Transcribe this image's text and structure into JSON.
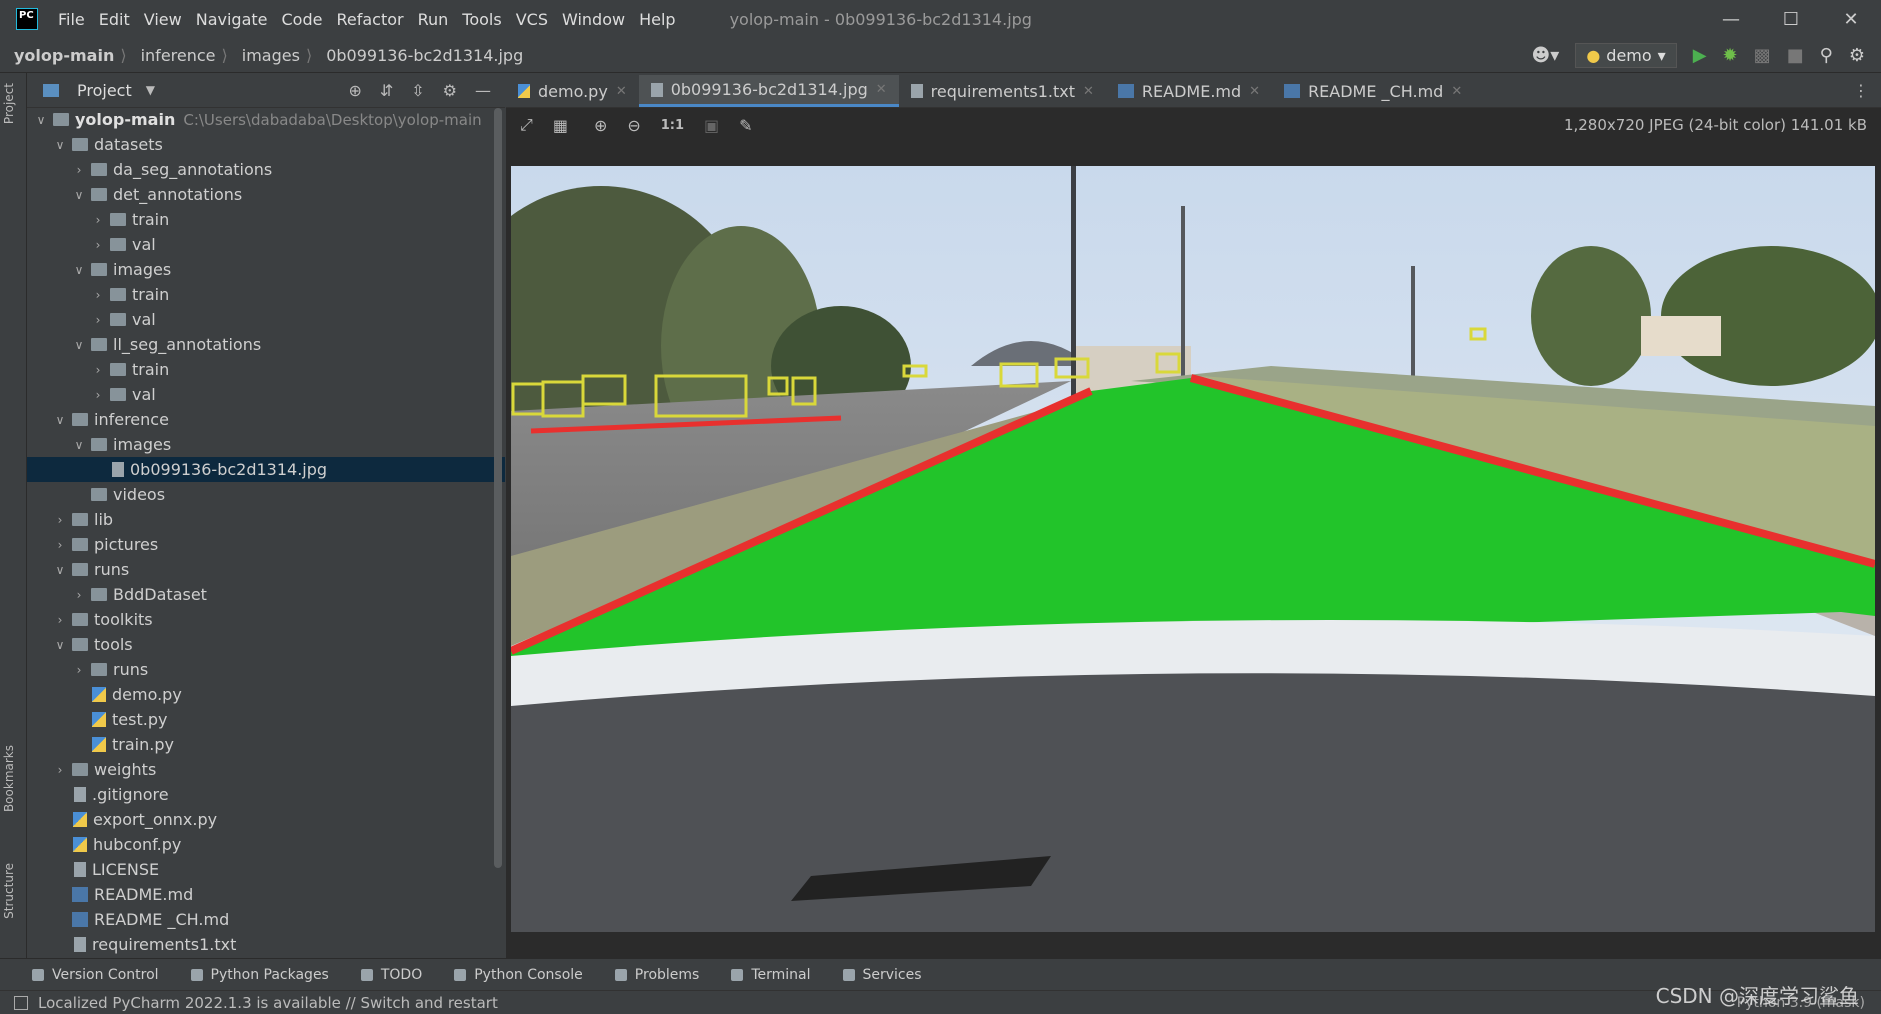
{
  "window": {
    "menu": [
      "File",
      "Edit",
      "View",
      "Navigate",
      "Code",
      "Refactor",
      "Run",
      "Tools",
      "VCS",
      "Window",
      "Help"
    ],
    "title": "yolop-main - 0b099136-bc2d1314.jpg"
  },
  "navbar": {
    "crumbs": [
      "yolop-main",
      "inference",
      "images",
      "0b099136-bc2d1314.jpg"
    ],
    "run_config": "demo"
  },
  "left_stripe": {
    "project": "Project",
    "bookmarks": "Bookmarks",
    "structure": "Structure"
  },
  "project": {
    "title": "Project",
    "root_path": "C:\\Users\\dabadaba\\Desktop\\yolop-main",
    "tree": [
      {
        "label": "yolop-main",
        "level": 0,
        "kind": "folder",
        "expanded": true,
        "bold": true
      },
      {
        "label": "datasets",
        "level": 1,
        "kind": "folder",
        "expanded": true
      },
      {
        "label": "da_seg_annotations",
        "level": 2,
        "kind": "folder",
        "expanded": false
      },
      {
        "label": "det_annotations",
        "level": 2,
        "kind": "folder",
        "expanded": true
      },
      {
        "label": "train",
        "level": 3,
        "kind": "folder",
        "expanded": false
      },
      {
        "label": "val",
        "level": 3,
        "kind": "folder",
        "expanded": false
      },
      {
        "label": "images",
        "level": 2,
        "kind": "folder",
        "expanded": true
      },
      {
        "label": "train",
        "level": 3,
        "kind": "folder",
        "expanded": false
      },
      {
        "label": "val",
        "level": 3,
        "kind": "folder",
        "expanded": false
      },
      {
        "label": "ll_seg_annotations",
        "level": 2,
        "kind": "folder",
        "expanded": true
      },
      {
        "label": "train",
        "level": 3,
        "kind": "folder",
        "expanded": false
      },
      {
        "label": "val",
        "level": 3,
        "kind": "folder",
        "expanded": false
      },
      {
        "label": "inference",
        "level": 1,
        "kind": "folder",
        "expanded": true
      },
      {
        "label": "images",
        "level": 2,
        "kind": "folder",
        "expanded": true
      },
      {
        "label": "0b099136-bc2d1314.jpg",
        "level": 3,
        "kind": "file",
        "selected": true
      },
      {
        "label": "videos",
        "level": 2,
        "kind": "folder",
        "leaf": true
      },
      {
        "label": "lib",
        "level": 1,
        "kind": "folder",
        "expanded": false
      },
      {
        "label": "pictures",
        "level": 1,
        "kind": "folder",
        "expanded": false
      },
      {
        "label": "runs",
        "level": 1,
        "kind": "folder",
        "expanded": true
      },
      {
        "label": "BddDataset",
        "level": 2,
        "kind": "folder",
        "expanded": false
      },
      {
        "label": "toolkits",
        "level": 1,
        "kind": "folder",
        "expanded": false
      },
      {
        "label": "tools",
        "level": 1,
        "kind": "folder",
        "expanded": true
      },
      {
        "label": "runs",
        "level": 2,
        "kind": "folder",
        "expanded": false
      },
      {
        "label": "demo.py",
        "level": 2,
        "kind": "py"
      },
      {
        "label": "test.py",
        "level": 2,
        "kind": "py"
      },
      {
        "label": "train.py",
        "level": 2,
        "kind": "py"
      },
      {
        "label": "weights",
        "level": 1,
        "kind": "folder",
        "expanded": false
      },
      {
        "label": ".gitignore",
        "level": 1,
        "kind": "file"
      },
      {
        "label": "export_onnx.py",
        "level": 1,
        "kind": "py"
      },
      {
        "label": "hubconf.py",
        "level": 1,
        "kind": "py"
      },
      {
        "label": "LICENSE",
        "level": 1,
        "kind": "file"
      },
      {
        "label": "README.md",
        "level": 1,
        "kind": "md"
      },
      {
        "label": "README _CH.md",
        "level": 1,
        "kind": "md"
      },
      {
        "label": "requirements1.txt",
        "level": 1,
        "kind": "file"
      }
    ]
  },
  "tabs": [
    {
      "label": "demo.py",
      "kind": "py"
    },
    {
      "label": "0b099136-bc2d1314.jpg",
      "kind": "file",
      "active": true
    },
    {
      "label": "requirements1.txt",
      "kind": "file"
    },
    {
      "label": "README.md",
      "kind": "md"
    },
    {
      "label": "README _CH.md",
      "kind": "md"
    }
  ],
  "image_toolbar": {
    "actual_size": "1:1",
    "info": "1,280x720 JPEG (24-bit color) 141.01 kB"
  },
  "bottom_tools": [
    "Version Control",
    "Python Packages",
    "TODO",
    "Python Console",
    "Problems",
    "Terminal",
    "Services"
  ],
  "status": {
    "message": "Localized PyCharm 2022.1.3 is available // Switch and restart",
    "interpreter": "Python 3.9 (mask)"
  },
  "watermark": "CSDN @深度学习鲨鱼",
  "colors": {
    "drivable_area": "#22c42a",
    "lane_line": "#e8302e",
    "detection_box": "#d9d83a",
    "selection": "#0d293e",
    "accent": "#4a88c7"
  }
}
